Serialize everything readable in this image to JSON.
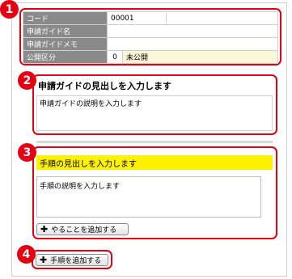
{
  "badges": [
    "1",
    "2",
    "3",
    "4"
  ],
  "header": {
    "code_label": "コード",
    "code_value": "00001",
    "guide_name_label": "申請ガイド名",
    "guide_memo_label": "申請ガイドメモ",
    "public_label": "公開区分",
    "public_value": "0",
    "public_status": "未公開"
  },
  "guide": {
    "title": "申請ガイドの見出しを入力します",
    "description": "申請ガイドの説明を入力します"
  },
  "step": {
    "title": "手順の見出しを入力します",
    "description": "手順の説明を入力します",
    "add_todo_label": "やることを追加する"
  },
  "add_step_label": "手順を追加する",
  "colors": {
    "accent_red": "#e60012",
    "step_header_yellow": "#fff200",
    "label_gray": "#8a8a8a",
    "status_bg": "#fbf8d9"
  },
  "icons": {
    "add": "plus-icon"
  }
}
